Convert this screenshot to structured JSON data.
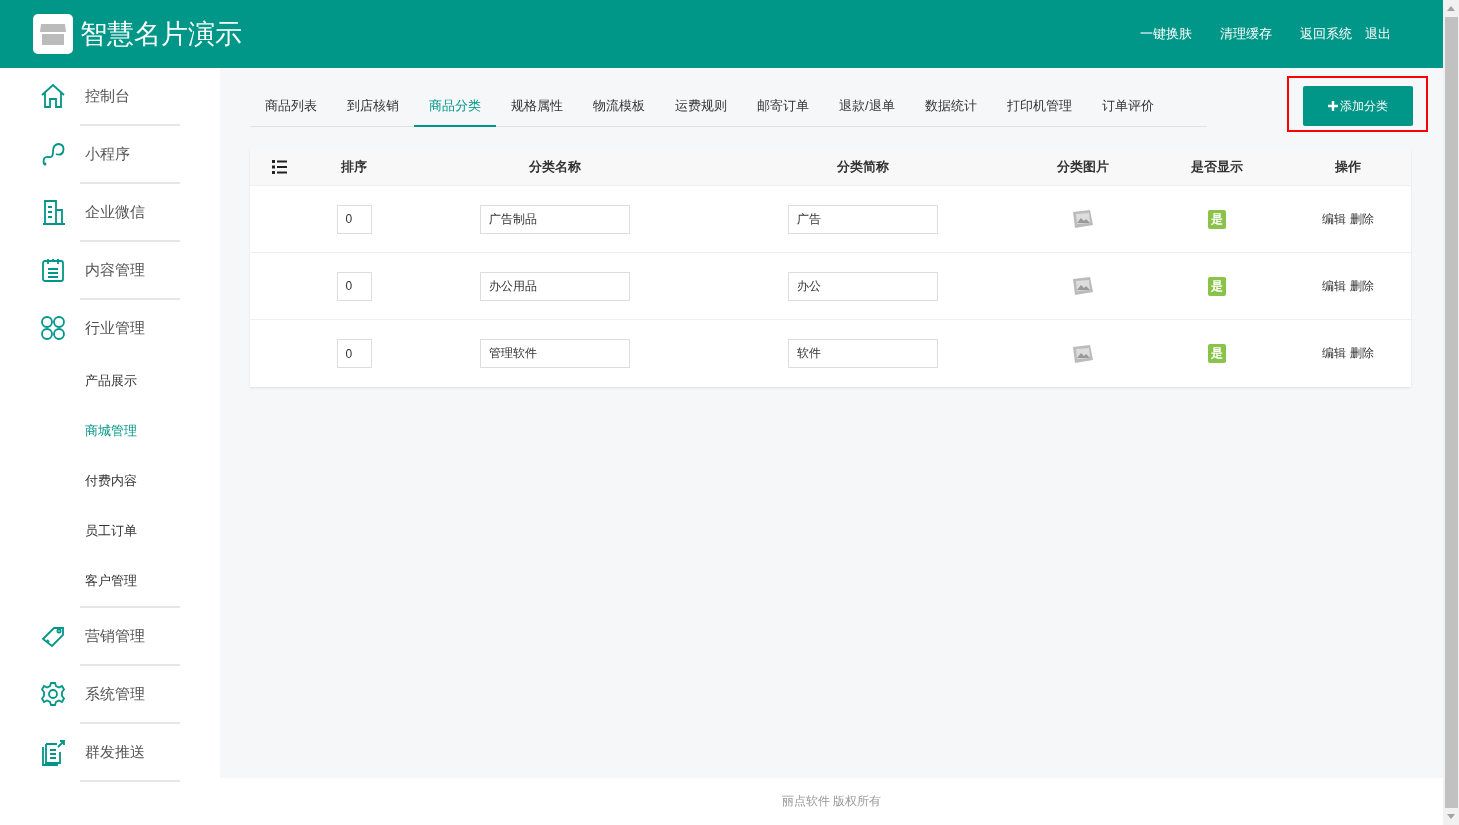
{
  "header": {
    "title": "智慧名片演示",
    "actions": [
      "一键换肤",
      "清理缓存",
      "返回系统",
      "退出"
    ]
  },
  "sidebar": {
    "items": [
      {
        "label": "控制台",
        "selected": false
      },
      {
        "label": "小程序",
        "selected": false
      },
      {
        "label": "企业微信",
        "selected": false
      },
      {
        "label": "内容管理",
        "selected": false
      },
      {
        "label": "行业管理",
        "selected": false,
        "children": [
          {
            "label": "产品展示",
            "selected": false
          },
          {
            "label": "商城管理",
            "selected": true
          },
          {
            "label": "付费内容",
            "selected": false
          },
          {
            "label": "员工订单",
            "selected": false
          },
          {
            "label": "客户管理",
            "selected": false
          }
        ]
      },
      {
        "label": "营销管理",
        "selected": false
      },
      {
        "label": "系统管理",
        "selected": false
      },
      {
        "label": "群发推送",
        "selected": false
      }
    ]
  },
  "tabs": [
    {
      "label": "商品列表",
      "selected": false
    },
    {
      "label": "到店核销",
      "selected": false
    },
    {
      "label": "商品分类",
      "selected": true
    },
    {
      "label": "规格属性",
      "selected": false
    },
    {
      "label": "物流模板",
      "selected": false
    },
    {
      "label": "运费规则",
      "selected": false
    },
    {
      "label": "邮寄订单",
      "selected": false
    },
    {
      "label": "退款/退单",
      "selected": false
    },
    {
      "label": "数据统计",
      "selected": false
    },
    {
      "label": "打印机管理",
      "selected": false
    },
    {
      "label": "订单评价",
      "selected": false
    }
  ],
  "add_button": {
    "label": "添加分类",
    "highlighted": true
  },
  "table": {
    "columns": [
      "排序",
      "分类名称",
      "分类简称",
      "分类图片",
      "是否显示",
      "操作"
    ],
    "rows": [
      {
        "sort": "0",
        "name": "广告制品",
        "short_name": "广告",
        "visible": true,
        "visible_label": "是",
        "actions": [
          "编辑",
          "删除"
        ]
      },
      {
        "sort": "0",
        "name": "办公用品",
        "short_name": "办公",
        "visible": true,
        "visible_label": "是",
        "actions": [
          "编辑",
          "删除"
        ]
      },
      {
        "sort": "0",
        "name": "管理软件",
        "short_name": "软件",
        "visible": true,
        "visible_label": "是",
        "actions": [
          "编辑",
          "删除"
        ]
      }
    ]
  },
  "footer": "丽点软件 版权所有"
}
